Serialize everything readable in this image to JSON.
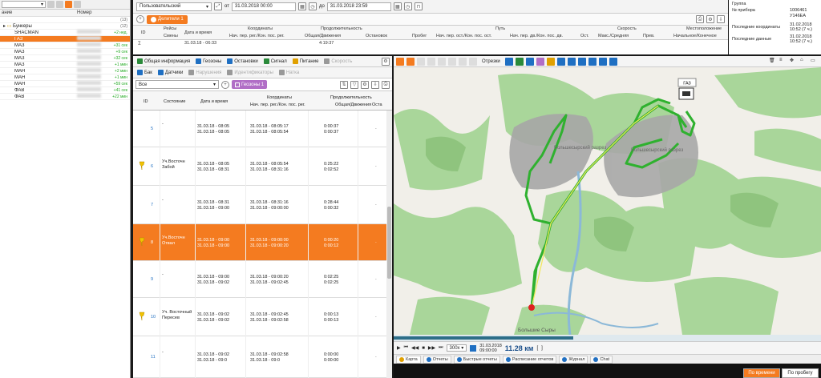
{
  "left": {
    "select": "",
    "col_name": "ание",
    "col_number": "Номер",
    "top_count": "(13)",
    "group_count": "(12)",
    "group": "Бункеры",
    "rows": [
      {
        "name": "SHACMAN",
        "status": "+2 нед."
      },
      {
        "name": "ГАЗ",
        "status": "",
        "selected": true
      },
      {
        "name": "МАЗ",
        "status": "+31 сек"
      },
      {
        "name": "МАЗ",
        "status": "+9 сек"
      },
      {
        "name": "МАЗ",
        "status": "+32 сек"
      },
      {
        "name": "МАЗ",
        "status": "+1 мин"
      },
      {
        "name": "МАН",
        "status": "+2 мин"
      },
      {
        "name": "МАН",
        "status": "+1 мин"
      },
      {
        "name": "МАН",
        "status": "+59 сек"
      },
      {
        "name": "ФАВ",
        "status": "+41 сек"
      },
      {
        "name": "ФАВ",
        "status": "+22 мин"
      }
    ]
  },
  "top": {
    "period_select": "Пользовательский",
    "from_label": "от",
    "from_value": "31.03.2018 00:00",
    "to_label": "до",
    "to_value": "31.03.2018 23:59",
    "tab_label": "Делители 1",
    "headers": [
      "ID",
      "Рейсы",
      "Смены",
      "Дата и время",
      "Координаты",
      "Нач. пер. рег./Кон. пос. рег.",
      "Продолжительность",
      "Общая/Движения",
      "Остановок",
      "Путь",
      "Пробег",
      "Нач. пер. ост./Кон. пос. ост.",
      "Нач. пер. дв./Кон. пос. дв.",
      "Ост.",
      "Скорость",
      "Макс./Средняя",
      "Прев.",
      "Местоположение",
      "Начальное/Конечное"
    ],
    "row_date": "31.03.18 - 06:33",
    "row_total": "4:19:37"
  },
  "info": {
    "group_label": "Группа",
    "device_label": "№ прибора",
    "device_value": "1006461",
    "plate_value": "У146ЕА",
    "coords_label": "Последние координаты",
    "coords_value": "31.02.2018 10:52 (7 ч.)",
    "data_label": "Последние данные",
    "data_value": "31.02.2018 10:52 (7 ч.)"
  },
  "mid": {
    "tabs": [
      {
        "label": "Общая информация",
        "color": "#2a8a3a"
      },
      {
        "label": "Геозоны",
        "color": "#1f6fc2"
      },
      {
        "label": "Остановки",
        "color": "#1f6fc2"
      },
      {
        "label": "Сигнал",
        "color": "#2a8a3a"
      },
      {
        "label": "Питание",
        "color": "#e0a000"
      },
      {
        "label": "Скорость",
        "color": "#999"
      }
    ],
    "tabs2": [
      {
        "label": "Бак",
        "color": "#1f6fc2"
      },
      {
        "label": "Датчики",
        "color": "#1f6fc2"
      },
      {
        "label": "Нарушения",
        "color": "#999"
      },
      {
        "label": "Идентификаторы",
        "color": "#999"
      },
      {
        "label": "Натка",
        "color": "#999"
      }
    ],
    "filter_value": "Все",
    "geo_tab": "Геозоны 1",
    "headers": {
      "id": "ID",
      "state": "Состояние",
      "datetime": "Дата и время",
      "coords": "Координаты",
      "coords_sub": "Нач. пер. рег./Кон. пос. рег.",
      "duration": "Продолжительность",
      "duration_sub": "Общая/Движения",
      "ost": "Оста"
    },
    "rows": [
      {
        "id": "5",
        "state": "-",
        "dt1": "31.03.18 - 08:05",
        "dt2": "31.03.18 - 08:05",
        "c1": "31.03.18 - 08:05:17",
        "c2": "31.03.18 - 08:05:54",
        "d1": "0:00:37",
        "d2": "0:00:37",
        "pin": false
      },
      {
        "id": "6",
        "state": "Уч.Восточн Забой",
        "dt1": "31.03.18 - 08:05",
        "dt2": "31.03.18 - 08:31",
        "c1": "31.03.18 - 08:05:54",
        "c2": "31.03.18 - 08:31:16",
        "d1": "0:25:22",
        "d2": "0:02:52",
        "pin": true
      },
      {
        "id": "7",
        "state": "-",
        "dt1": "31.03.18 - 08:31",
        "dt2": "31.03.18 - 09:00",
        "c1": "31.03.18 - 08:31:16",
        "c2": "31.03.18 - 09:00:00",
        "d1": "0:28:44",
        "d2": "0:00:32",
        "pin": false
      },
      {
        "id": "8",
        "state": "Уч.Восточн Отвал",
        "dt1": "31.03.18 - 09:00",
        "dt2": "31.03.18 - 09:00",
        "c1": "31.03.18 - 09:00:00",
        "c2": "31.03.18 - 09:00:20",
        "d1": "0:00:20",
        "d2": "0:00:12",
        "pin": true,
        "selected": true
      },
      {
        "id": "9",
        "state": "-",
        "dt1": "31.03.18 - 09:00",
        "dt2": "31.03.18 - 09:02",
        "c1": "31.03.18 - 09:00:20",
        "c2": "31.03.18 - 09:02:45",
        "d1": "0:02:25",
        "d2": "0:02:25",
        "pin": false
      },
      {
        "id": "10",
        "state": "Уч. Восточный Пересев",
        "dt1": "31.03.18 - 09:02",
        "dt2": "31.03.18 - 09:02",
        "c1": "31.03.18 - 09:02:45",
        "c2": "31.03.18 - 09:02:58",
        "d1": "0:00:13",
        "d2": "0:00:13",
        "pin": true
      },
      {
        "id": "11",
        "state": "-",
        "dt1": "31.03.18 - 09:02",
        "dt2": "31.03.18 - 09:0",
        "c1": "31.03.18 - 09:02:58",
        "c2": "31.03.18 - 09:0",
        "d1": "0:00:00",
        "d2": "0:00:00",
        "pin": false
      }
    ]
  },
  "map": {
    "cut_label": "Отрезки",
    "vehicle_label": "ГАЗ",
    "area1": "Большесырский разрез",
    "area2": "Большесырский разрез",
    "town": "Большие Сыры",
    "play_speed": "300x",
    "play_date": "31.03.2018",
    "play_time": "09:00:00",
    "distance": "11.28 км",
    "progress": 0.42,
    "bottom_tabs": [
      {
        "label": "Карта",
        "active": true
      },
      {
        "label": "Отчеты"
      },
      {
        "label": "Быстрые отчеты"
      },
      {
        "label": "Расписание отчетов"
      },
      {
        "label": "Журнал"
      },
      {
        "label": "Chat"
      }
    ],
    "btn_by_time": "По времени",
    "btn_by_mileage": "По пробегу"
  }
}
